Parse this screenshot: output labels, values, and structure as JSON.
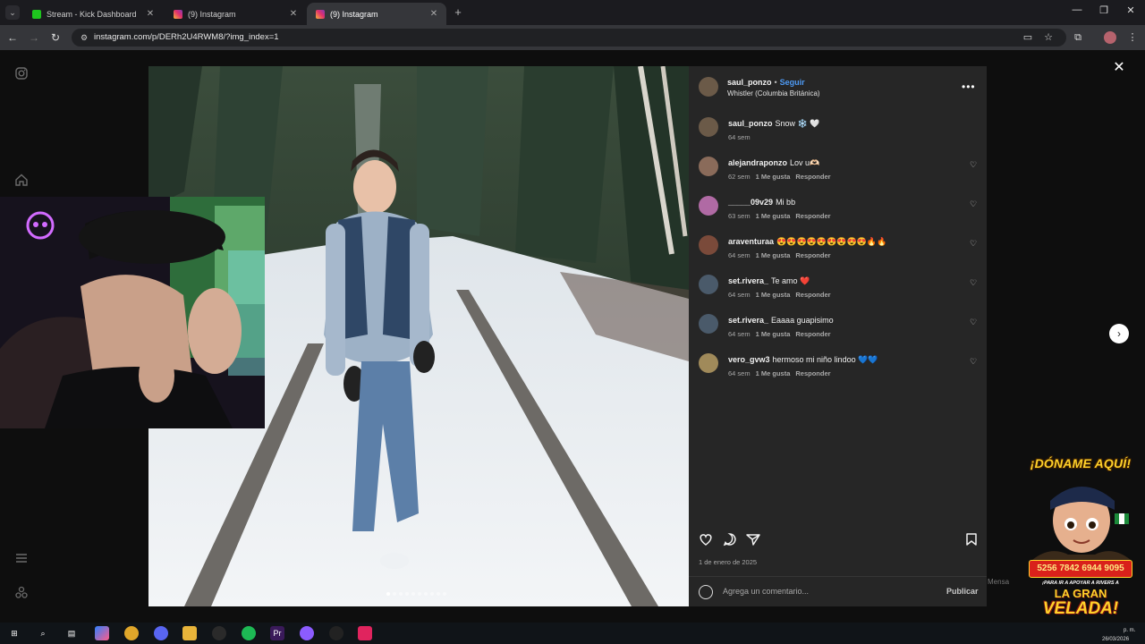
{
  "browser": {
    "tabs": [
      {
        "title": "Stream - Kick Dashboard",
        "favicon": "kick-icon",
        "active": false
      },
      {
        "title": "(9) Instagram",
        "favicon": "instagram-icon",
        "active": false
      },
      {
        "title": "(9) Instagram",
        "favicon": "instagram-icon",
        "active": true
      }
    ],
    "url": "instagram.com/p/DERh2U4RWM8/?img_index=1"
  },
  "post": {
    "username": "saul_ponzo",
    "dot": "•",
    "follow_label": "Seguir",
    "location": "Whistler (Columbia Británica)",
    "more": "•••",
    "caption": {
      "user": "saul_ponzo",
      "text": "Snow ❄️ 🤍",
      "time": "64 sem"
    },
    "comments": [
      {
        "user": "alejandraponzo",
        "text": "Lov u🫶🏻",
        "time": "62 sem",
        "likes": "1 Me gusta",
        "reply": "Responder",
        "avatar": "#8a6b5a"
      },
      {
        "user": "_____09v29",
        "text": "Mi bb",
        "time": "63 sem",
        "likes": "1 Me gusta",
        "reply": "Responder",
        "avatar": "#b06aa4"
      },
      {
        "user": "araventuraa",
        "text": "😍😍😍😍😍😍😍😍😍🔥🔥",
        "time": "64 sem",
        "likes": "1 Me gusta",
        "reply": "Responder",
        "avatar": "#7a4a3a"
      },
      {
        "user": "set.rivera_",
        "text": "Te amo ❤️",
        "time": "64 sem",
        "likes": "1 Me gusta",
        "reply": "Responder",
        "avatar": "#4a5a6a"
      },
      {
        "user": "set.rivera_",
        "text": "Eaaaa guapisimo",
        "time": "64 sem",
        "likes": "1 Me gusta",
        "reply": "Responder",
        "avatar": "#4a5a6a"
      },
      {
        "user": "vero_gvw3",
        "text": "hermoso mi niño lindoo 💙💙",
        "time": "64 sem",
        "likes": "1 Me gusta",
        "reply": "Responder",
        "avatar": "#a08a5a"
      }
    ],
    "date": "1 de enero de 2025",
    "add_comment_placeholder": "Agrega un comentario...",
    "publish_label": "Publicar"
  },
  "overlay": {
    "donate_title": "¡DÓNAME AQUÍ!",
    "phone": "5256 7842 6944 9095",
    "subtitle": "¡PARA IR A APOYAR A RIVERS A",
    "event_la": "LA GRAN",
    "event_velada": "VELADA!"
  },
  "side_text": "Mensa",
  "taskbar": {
    "time": "p. m.",
    "date": "26/03/2026"
  }
}
